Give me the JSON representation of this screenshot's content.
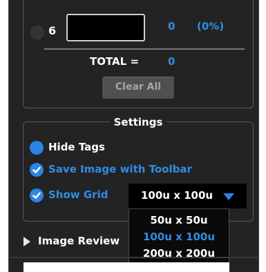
{
  "counter_panel": {
    "row_number": "6",
    "row_count": "0",
    "row_percent": "(0%)",
    "total_label": "TOTAL =",
    "total_value": "0",
    "clear_all_label": "Clear All"
  },
  "settings": {
    "title": "Settings",
    "hide_tags_label": "Hide Tags",
    "save_image_label": "Save Image with Toolbar",
    "show_grid_label": "Show Grid",
    "grid_size_selected": "100u x 100u",
    "grid_size_options": [
      "50u x 50u",
      "100u x 100u",
      "200u x 200u"
    ]
  },
  "image_review": {
    "label": "Image Review"
  },
  "colors": {
    "accent": "#2d83e6",
    "background": "#232323",
    "text": "#ffffff"
  }
}
